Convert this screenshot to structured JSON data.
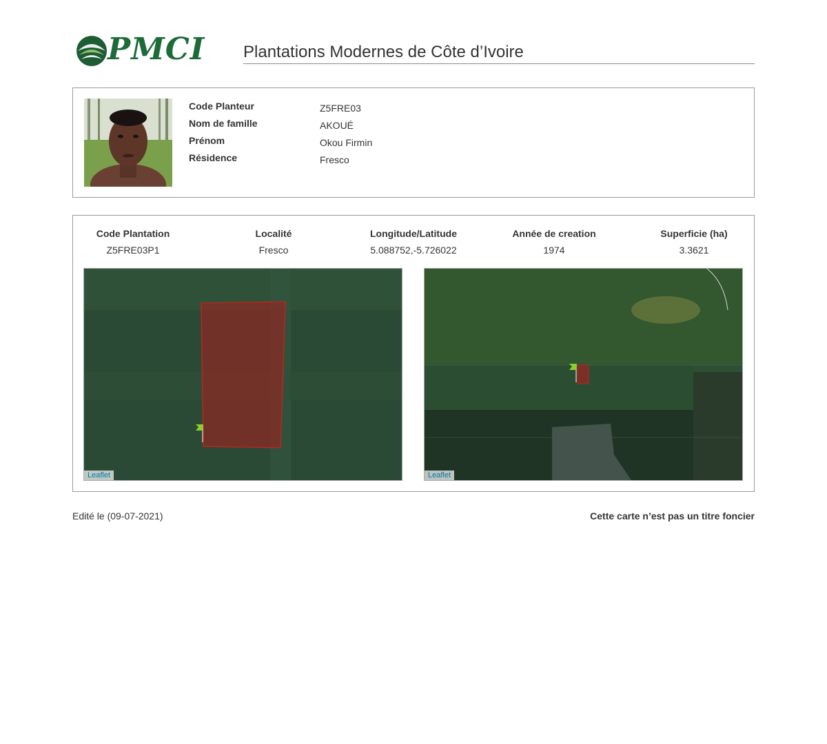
{
  "header": {
    "logo_text": "PMCI",
    "title": "Plantations Modernes de Côte d’Ivoire"
  },
  "planter": {
    "photo_alt": "",
    "fields": [
      {
        "label": "Code Planteur",
        "value": "Z5FRE03"
      },
      {
        "label": "Nom de famille",
        "value": "AKOUÉ"
      },
      {
        "label": "Prénom",
        "value": "Okou Firmin"
      },
      {
        "label": "Résidence",
        "value": "Fresco"
      }
    ]
  },
  "plantation": {
    "columns": [
      {
        "header": "Code Plantation",
        "value": "Z5FRE03P1"
      },
      {
        "header": "Localité",
        "value": "Fresco"
      },
      {
        "header": "Longitude/Latitude",
        "value": "5.088752,-5.726022"
      },
      {
        "header": "Année de creation",
        "value": "1974"
      },
      {
        "header": "Superficie (ha)",
        "value": "3.3621"
      }
    ],
    "map_attribution": "Leaflet",
    "plot_color": "#8b2a24",
    "marker_color": "#8ad02a"
  },
  "footer": {
    "edited": "Edité le (09-07-2021)",
    "disclaimer": "Cette carte n’est pas un titre foncier"
  }
}
